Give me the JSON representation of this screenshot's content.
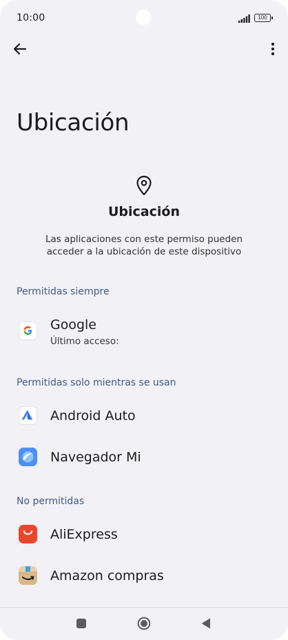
{
  "status_bar": {
    "time": "10:00",
    "battery": "100"
  },
  "toolbar": {
    "back_icon": "arrow-left-icon",
    "more_icon": "more-vert-icon"
  },
  "page": {
    "title": "Ubicación"
  },
  "header": {
    "icon": "location-pin-icon",
    "title": "Ubicación",
    "description": "Las aplicaciones con este permiso pueden acceder a la ubicación de este dispositivo"
  },
  "sections": [
    {
      "label": "Permitidas siempre",
      "apps": [
        {
          "name": "Google",
          "subtitle": "Último acceso:",
          "icon": "google-icon"
        }
      ]
    },
    {
      "label": "Permitidas solo mientras se usan",
      "apps": [
        {
          "name": "Android Auto",
          "icon": "android-auto-icon"
        },
        {
          "name": "Navegador Mi",
          "icon": "mi-browser-icon"
        }
      ]
    },
    {
      "label": "No permitidas",
      "apps": [
        {
          "name": "AliExpress",
          "icon": "aliexpress-icon"
        },
        {
          "name": "Amazon compras",
          "icon": "amazon-icon"
        }
      ]
    }
  ],
  "nav_bar": {
    "recents": "square-icon",
    "home": "circle-icon",
    "back": "triangle-back-icon"
  },
  "colors": {
    "background": "#f2f1f6",
    "section_label": "#3f5b85",
    "aliexpress": "#e8472b",
    "amazon": "#d9b88a",
    "mi_browser": "#4f8ff0"
  }
}
